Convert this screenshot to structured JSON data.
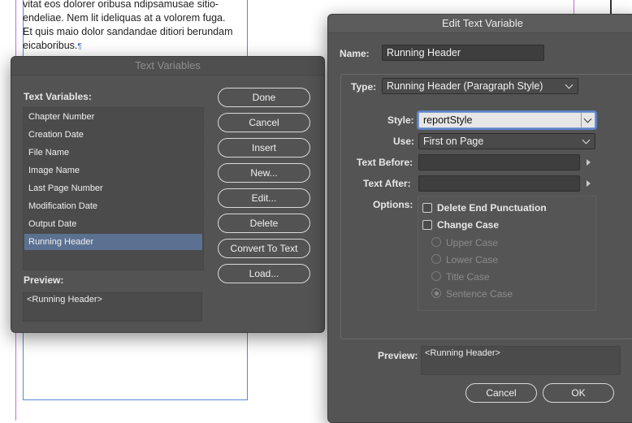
{
  "document": {
    "text_lines": [
      "vitat eos dolorer oribusa ndipsamusae sitio-",
      "endeliae. Nem lit ideliquas at a volorem fuga.",
      "Et quis maio dolor sandandae ditiori berundam",
      "eicaboribus."
    ],
    "pilcrow": "¶"
  },
  "text_variables_dialog": {
    "title": "Text Variables",
    "list_label": "Text Variables:",
    "items": [
      "Chapter Number",
      "Creation Date",
      "File Name",
      "Image Name",
      "Last Page Number",
      "Modification Date",
      "Output Date",
      "Running Header"
    ],
    "selected_index": 7,
    "preview_label": "Preview:",
    "preview_value": "<Running Header>",
    "buttons": {
      "done": "Done",
      "cancel": "Cancel",
      "insert": "Insert",
      "new": "New...",
      "edit": "Edit...",
      "delete": "Delete",
      "convert": "Convert To Text",
      "load": "Load..."
    }
  },
  "edit_dialog": {
    "title": "Edit Text Variable",
    "name_label": "Name:",
    "name_value": "Running Header",
    "type_label": "Type:",
    "type_value": "Running Header (Paragraph Style)",
    "style_label": "Style:",
    "style_value": "reportStyle",
    "use_label": "Use:",
    "use_value": "First on Page",
    "text_before_label": "Text Before:",
    "text_before_value": "",
    "text_after_label": "Text After:",
    "text_after_value": "",
    "options_label": "Options:",
    "delete_end_punct": "Delete End Punctuation",
    "change_case": "Change Case",
    "case_options": [
      "Upper Case",
      "Lower Case",
      "Title Case",
      "Sentence Case"
    ],
    "selected_case_index": 3,
    "preview_label": "Preview:",
    "preview_value": "<Running Header>",
    "cancel": "Cancel",
    "ok": "OK"
  },
  "colors": {
    "dialog_bg": "#535353",
    "selection": "#5b7191",
    "guide_magenta": "#c56fd3",
    "guide_blue": "#5b86d8"
  }
}
